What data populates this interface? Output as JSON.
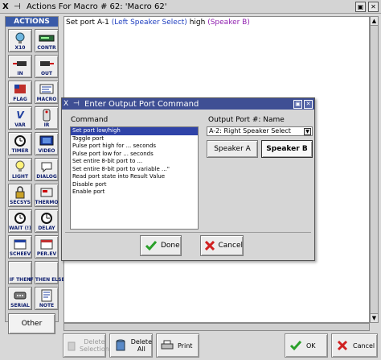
{
  "window": {
    "icon": "X",
    "pin": "⊣",
    "title": "Actions For Macro # 62: 'Macro 62'",
    "buttons": [
      "▣",
      "✕"
    ]
  },
  "palette": {
    "header": "ACTIONS",
    "tools": [
      {
        "label": "X10",
        "icon": "x10-icon"
      },
      {
        "label": "CONTR",
        "icon": "controller-icon"
      },
      {
        "label": "IN",
        "icon": "input-icon"
      },
      {
        "label": "OUT",
        "icon": "output-icon"
      },
      {
        "label": "FLAG",
        "icon": "flag-icon"
      },
      {
        "label": "MACRO",
        "icon": "macro-icon"
      },
      {
        "label": "VAR",
        "icon": "variable-icon"
      },
      {
        "label": "IR",
        "icon": "ir-icon"
      },
      {
        "label": "TIMER",
        "icon": "timer-icon"
      },
      {
        "label": "VIDEO",
        "icon": "video-icon"
      },
      {
        "label": "LIGHT",
        "icon": "light-icon"
      },
      {
        "label": "DIALOG",
        "icon": "dialog-icon"
      },
      {
        "label": "SECSYS",
        "icon": "security-icon"
      },
      {
        "label": "THERMO",
        "icon": "thermostat-icon"
      },
      {
        "label": "WAIT (!)",
        "icon": "wait-icon"
      },
      {
        "label": "DELAY",
        "icon": "delay-icon"
      },
      {
        "label": "SCHEEV",
        "icon": "schedule-event-icon"
      },
      {
        "label": "PER.EV",
        "icon": "periodic-event-icon"
      },
      {
        "label": "IF THEN",
        "icon": "if-then-icon"
      },
      {
        "label": "IF THEN ELSE",
        "icon": "if-then-else-icon"
      },
      {
        "label": "SERIAL",
        "icon": "serial-icon"
      },
      {
        "label": "NOTE",
        "icon": "note-icon"
      }
    ],
    "other_label": "Other"
  },
  "editor": {
    "line_prefix": "Set port A-1",
    "line_port": "(Left Speaker Select)",
    "line_state": "high",
    "line_name": "(Speaker B)"
  },
  "bottom": {
    "delete_selection": [
      "Delete",
      "Selection"
    ],
    "delete_all": [
      "Delete",
      "All"
    ],
    "print": "Print",
    "ok": "OK",
    "cancel": "Cancel"
  },
  "dialog": {
    "title": "Enter Output Port Command",
    "command_label": "Command",
    "port_label": "Output Port #: Name",
    "commands": [
      "Set port low/high",
      "Toggle port",
      "Pulse port high for ... seconds",
      "Pulse port low for ... seconds",
      "Set entire 8-bit port to ...",
      "Set entire 8-bit port to variable ...\"",
      "Read port state into Result Value",
      "Disable port",
      "Enable port"
    ],
    "selected_index": 0,
    "port_value": "A-2: Right Speaker Select",
    "speaker_a": "Speaker A",
    "speaker_b": "Speaker B",
    "active_speaker": "Speaker B",
    "done_label": "Done",
    "cancel_label": "Cancel"
  },
  "colors": {
    "accent": "#3f4f94",
    "selection": "#2f43a8",
    "port_text": "#2040c0",
    "name_text": "#9020b0",
    "ok_green": "#2aa02a",
    "cancel_red": "#d02020"
  }
}
